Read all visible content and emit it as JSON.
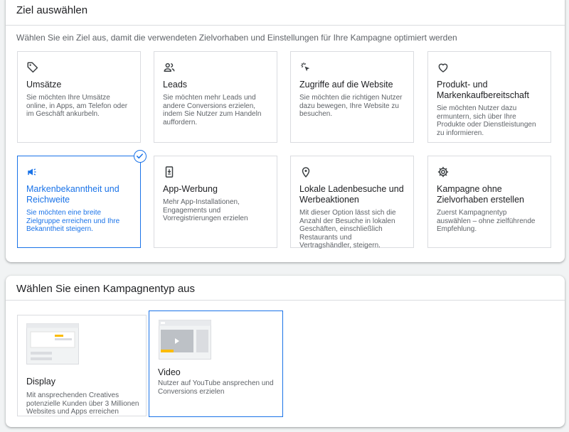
{
  "goal_section": {
    "header": "Ziel auswählen",
    "subtitle": "Wählen Sie ein Ziel aus, damit die verwendeten Zielvorhaben und Einstellungen für Ihre Kampagne optimiert werden",
    "cards": [
      {
        "title": "Umsätze",
        "desc": "Sie möchten Ihre Umsätze online, in Apps, am Telefon oder im Geschäft ankurbeln.",
        "icon": "tag-icon"
      },
      {
        "title": "Leads",
        "desc": "Sie möchten mehr Leads und andere Conversions erzielen, indem Sie Nutzer zum Handeln auffordern.",
        "icon": "people-icon"
      },
      {
        "title": "Zugriffe auf die Website",
        "desc": "Sie möchten die richtigen Nutzer dazu bewegen, Ihre Website zu besuchen.",
        "icon": "cursor-click-icon"
      },
      {
        "title": "Produkt- und Markenkaufbereitschaft",
        "desc": "Sie möchten Nutzer dazu ermuntern, sich über Ihre Produkte oder Dienstleistungen zu informieren.",
        "icon": "heart-icon"
      },
      {
        "title": "Markenbekanntheit und Reichweite",
        "desc": "Sie möchten eine breite Zielgruppe erreichen und Ihre Bekanntheit steigern.",
        "icon": "megaphone-icon",
        "selected": true
      },
      {
        "title": "App-Werbung",
        "desc": "Mehr App-Installationen, Engagements und Vorregistrierungen erzielen",
        "icon": "phone-download-icon"
      },
      {
        "title": "Lokale Ladenbesuche und Werbeaktionen",
        "desc": "Mit dieser Option lässt sich die Anzahl der Besuche in lokalen Geschäften, einschließlich Restaurants und Vertragshändler, steigern.",
        "icon": "location-pin-icon"
      },
      {
        "title": "Kampagne ohne Zielvorhaben erstellen",
        "desc": "Zuerst Kampagnentyp auswählen – ohne zielführende Empfehlung.",
        "icon": "gear-icon"
      }
    ]
  },
  "type_section": {
    "header": "Wählen Sie einen Kampagnentyp aus",
    "cards": [
      {
        "title": "Display",
        "desc": "Mit ansprechenden Creatives potenzielle Kunden über 3 Millionen Websites und Apps erreichen"
      },
      {
        "title": "Video",
        "desc": "Nutzer auf YouTube ansprechen und Conversions erzielen",
        "selected": true
      }
    ]
  },
  "colors": {
    "accent": "#1a73e8",
    "accent_yellow": "#fbbc04",
    "border": "#dadce0",
    "text_secondary": "#5f6368"
  }
}
